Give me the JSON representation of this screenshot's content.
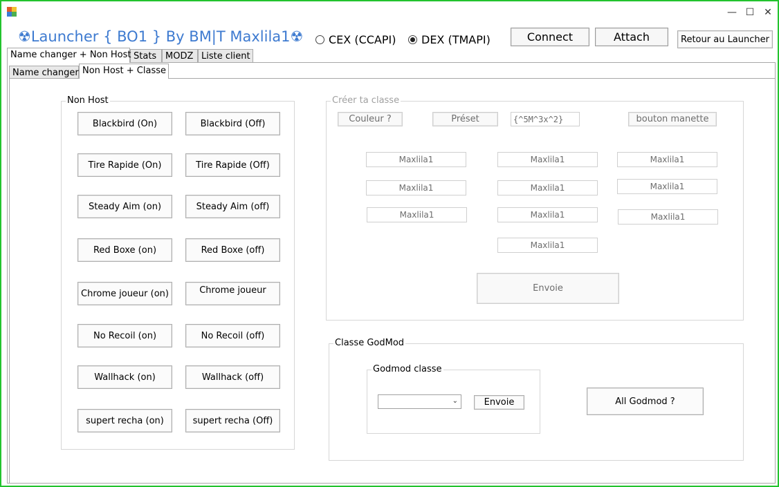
{
  "window": {
    "minimize": "—",
    "maximize": "☐",
    "close": "✕"
  },
  "header": {
    "title": "☢Launcher { BO1 }  By BM|T Maxlila1☢",
    "radio_cex": "CEX (CCAPI)",
    "radio_dex": "DEX (TMAPI)",
    "selected_api": "DEX (TMAPI)",
    "connect": "Connect",
    "attach": "Attach",
    "back": "Retour au Launcher"
  },
  "tabs": {
    "main": [
      "Name changer + Non Host",
      "Stats",
      "MODZ",
      "Liste client"
    ],
    "sub": [
      "Name changer",
      "Non Host + Classe"
    ]
  },
  "nonhost": {
    "legend": "Non Host",
    "buttons": [
      [
        "Blackbird (On)",
        "Blackbird (Off)"
      ],
      [
        "Tire Rapide (On)",
        "Tire Rapide (Off)"
      ],
      [
        "Steady Aim (on)",
        "Steady Aim (off)"
      ],
      [
        "Red Boxe (on)",
        "Red Boxe (off)"
      ],
      [
        "Chrome joueur (on)",
        "Chrome joueur"
      ],
      [
        "No Recoil (on)",
        "No Recoil (off)"
      ],
      [
        "Wallhack (on)",
        "Wallhack (off)"
      ],
      [
        "supert recha (on)",
        "supert recha (Off)"
      ]
    ]
  },
  "classe": {
    "legend": "Créer ta classe",
    "couleur": "Couleur ?",
    "preset": "Préset",
    "code_value": "{^5M^3x^2}",
    "manette": "bouton manette",
    "fields": [
      "Maxlila1",
      "Maxlila1",
      "Maxlila1",
      "Maxlila1",
      "Maxlila1",
      "Maxlila1",
      "Maxlila1",
      "Maxlila1",
      "Maxlila1",
      "Maxlila1"
    ],
    "send": "Envoie"
  },
  "godmod": {
    "legend": "Classe GodMod",
    "inner_legend": "Godmod classe",
    "combo_value": "",
    "send": "Envoie",
    "all": "All Godmod ?"
  },
  "colors": {
    "title_blue": "#3d7ad0",
    "window_border": "#22c32e"
  }
}
